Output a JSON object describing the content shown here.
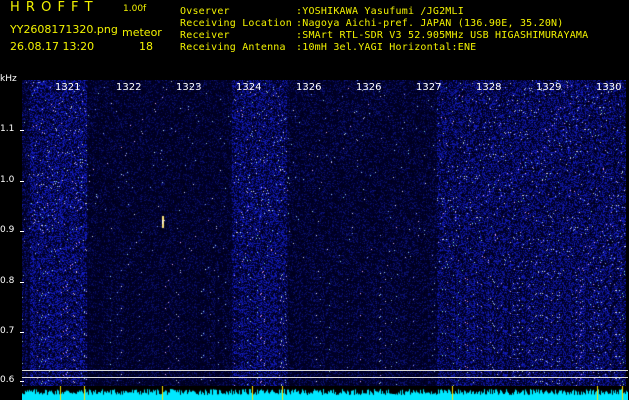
{
  "app": {
    "title": "H R O F F T",
    "version": "1.00f",
    "filename": "YY2608171320.png",
    "datetime": "26.08.17 13:20",
    "meteor_label": "meteor",
    "meteor_count": "18"
  },
  "info": {
    "observer_key": "Ovserver",
    "observer_val": ":YOSHIKAWA Yasufumi /JG2MLI",
    "location_key": "Receiving Location",
    "location_val": ":Nagoya Aichi-pref. JAPAN (136.90E, 35.20N)",
    "receiver_key": "Receiver",
    "receiver_val": ":SMArt RTL-SDR V3 52.905MHz USB HIGASHIMURAYAMA",
    "antenna_key": "Receiving Antenna",
    "antenna_val": ":10mH 3el.YAGI Horizontal:ENE"
  },
  "y_axis": {
    "unit": "kHz",
    "ticks": [
      "1.1",
      "1.0",
      "0.9",
      "0.8",
      "0.7",
      "0.6"
    ]
  },
  "x_axis": {
    "ticks": [
      "1321",
      "1322",
      "1323",
      "1324",
      "1326",
      "1326",
      "1327",
      "1328",
      "1329",
      "1330"
    ]
  },
  "colors": {
    "background": "#000000",
    "noise_dark": "#0a0a60",
    "noise_bright": "#3c5cff",
    "trace": "#00e8ff",
    "title": "#f2f200"
  }
}
